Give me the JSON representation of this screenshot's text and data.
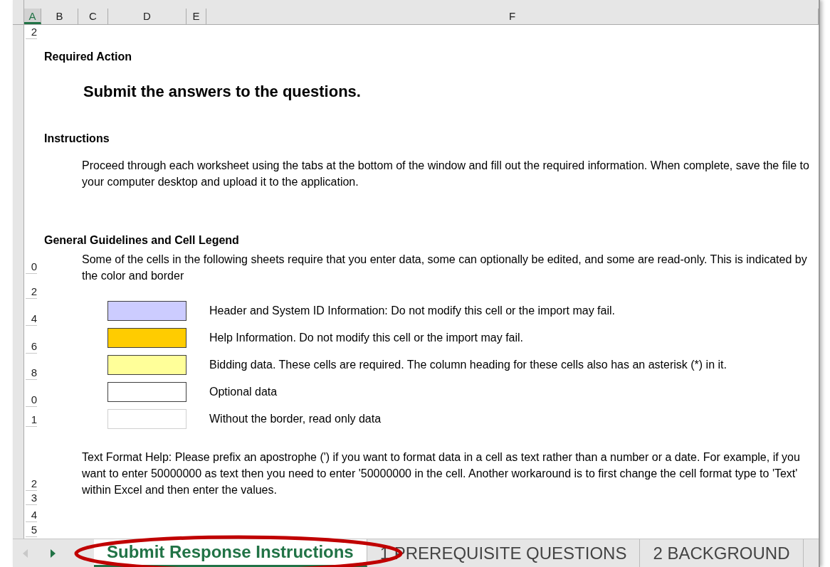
{
  "columns": [
    {
      "label": "A",
      "selected": true
    },
    {
      "label": "B",
      "selected": false
    },
    {
      "label": "C",
      "selected": false
    },
    {
      "label": "D",
      "selected": false
    },
    {
      "label": "E",
      "selected": false
    },
    {
      "label": "F",
      "selected": false
    }
  ],
  "row_headers": [
    "2",
    "0",
    "2",
    "4",
    "6",
    "8",
    "0",
    "1",
    "2",
    "3",
    "4",
    "5"
  ],
  "required_action": {
    "heading": "Required Action",
    "title": "Submit the answers to the questions."
  },
  "instructions": {
    "heading": "Instructions",
    "text": "Proceed through each worksheet using the tabs at the bottom of the window and fill out the required information. When complete, save the file to your computer desktop and upload it to the application."
  },
  "guidelines": {
    "heading": "General Guidelines and Cell Legend",
    "text": "Some of the cells in the following sheets require that you enter data, some can optionally be edited, and some are read-only.  This is indicated by the color and border",
    "legend": [
      {
        "color": "#ccccff",
        "bordered": true,
        "text": "Header and System ID Information: Do not modify this cell or the import may fail."
      },
      {
        "color": "#ffcc00",
        "bordered": true,
        "text": "Help Information. Do not modify this cell or the import may fail."
      },
      {
        "color": "#ffff99",
        "bordered": true,
        "text": "Bidding data. These cells are required. The column heading for these cells also has an asterisk (*) in it."
      },
      {
        "color": "#ffffff",
        "bordered": true,
        "text": "Optional data"
      },
      {
        "color": "#ffffff",
        "bordered": false,
        "text": "Without the border, read only data"
      }
    ]
  },
  "format_help": "Text Format Help: Please prefix an apostrophe (') if you want to format data in a cell as text rather than a number or a date. For example, if you want to enter 50000000 as text then you need to enter '50000000 in the cell. Another workaround is to first change the cell format type to 'Text' within Excel and then enter the values.",
  "sheet_tabs": [
    {
      "label": "Submit Response Instructions",
      "selected": true,
      "circled": true
    },
    {
      "label": "1 PREREQUISITE QUESTIONS",
      "selected": false,
      "circled": false
    },
    {
      "label": "2 BACKGROUND",
      "selected": false,
      "circled": false
    }
  ]
}
